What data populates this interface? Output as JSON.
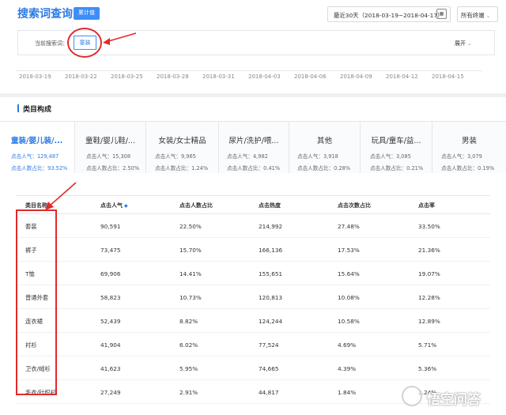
{
  "header": {
    "title": "搜索词查询",
    "tag": "累计值",
    "date_range": "最近30天（2018-03-19~2018-04-17）",
    "terminal": "所有终端"
  },
  "filter": {
    "label": "当前搜索词：",
    "keyword": "童装",
    "expand": "展开"
  },
  "timeline": {
    "dates": [
      "2018-03-19",
      "2018-03-22",
      "2018-03-25",
      "2018-03-28",
      "2018-03-31",
      "2018-04-03",
      "2018-04-06",
      "2018-04-09",
      "2018-04-12",
      "2018-04-15"
    ]
  },
  "section": {
    "title": "类目构成"
  },
  "categories": [
    {
      "name": "童装/婴儿装/...",
      "line1": "点击人气：129,487",
      "line2": "点击人数占比：93.52%"
    },
    {
      "name": "童鞋/婴儿鞋/...",
      "line1": "点击人气：15,308",
      "line2": "点击人数占比：2.50%"
    },
    {
      "name": "女装/女士精品",
      "line1": "点击人气：9,965",
      "line2": "点击人数占比：1.24%"
    },
    {
      "name": "尿片/洗护/喂...",
      "line1": "点击人气：4,982",
      "line2": "点击人数占比：0.41%"
    },
    {
      "name": "其他",
      "line1": "点击人气：3,918",
      "line2": "点击人数占比：0.28%"
    },
    {
      "name": "玩具/童车/益...",
      "line1": "点击人气：3,085",
      "line2": "点击人数占比：0.21%"
    },
    {
      "name": "男装",
      "line1": "点击人气：3,079",
      "line2": "点击人数占比：0.19%"
    }
  ],
  "table": {
    "headers": [
      "类目名称",
      "点击人气",
      "点击人数占比",
      "点击热度",
      "点击次数占比",
      "点击率"
    ],
    "rows": [
      [
        "套装",
        "90,591",
        "22.50%",
        "214,992",
        "27.48%",
        "33.50%"
      ],
      [
        "裤子",
        "73,475",
        "15.70%",
        "166,136",
        "17.53%",
        "21.36%"
      ],
      [
        "T恤",
        "69,906",
        "14.41%",
        "155,651",
        "15.64%",
        "19.07%"
      ],
      [
        "普通外套",
        "58,823",
        "10.73%",
        "120,813",
        "10.08%",
        "12.28%"
      ],
      [
        "连衣裙",
        "52,439",
        "8.82%",
        "124,244",
        "10.58%",
        "12.89%"
      ],
      [
        "衬衫",
        "41,904",
        "6.02%",
        "77,524",
        "4.69%",
        "5.71%"
      ],
      [
        "卫衣/绒衫",
        "41,623",
        "5.95%",
        "74,665",
        "4.39%",
        "5.36%"
      ],
      [
        "毛衣/针织衫",
        "27,249",
        "2.91%",
        "44,817",
        "1.84%",
        "2.24%"
      ]
    ]
  },
  "watermark": {
    "text": "悟空问答"
  }
}
